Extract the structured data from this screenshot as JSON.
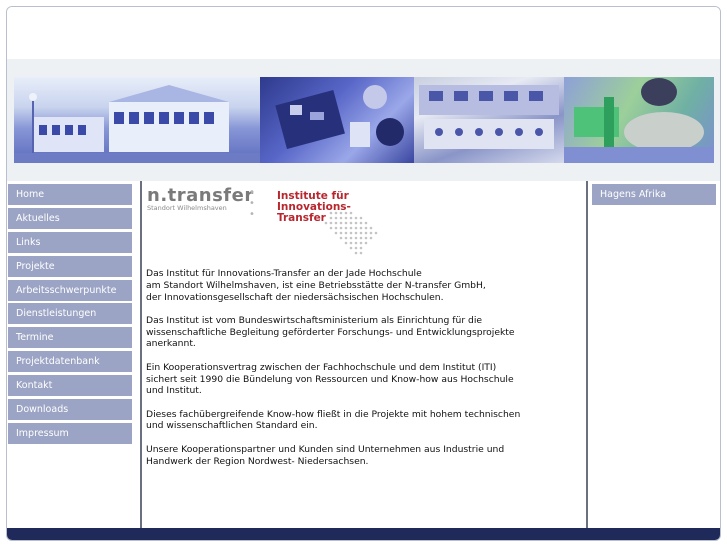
{
  "nav": {
    "items": [
      {
        "label": "Home"
      },
      {
        "label": "Aktuelles"
      },
      {
        "label": "Links"
      },
      {
        "label": "Projekte"
      },
      {
        "label": "Arbeitsschwerpunkte"
      },
      {
        "label": "Dienstleistungen"
      },
      {
        "label": "Termine"
      },
      {
        "label": "Projektdatenbank"
      },
      {
        "label": "Kontakt"
      },
      {
        "label": "Downloads"
      },
      {
        "label": "Impressum"
      }
    ]
  },
  "sidebar": {
    "link": "Hagens Afrika"
  },
  "logos": {
    "ntransfer": "n.transfer",
    "ntransfer_sub": "Standort Wilhelmshaven",
    "institute_line1": "Institute für",
    "institute_line2": "Innovations-",
    "institute_line3": "Transfer"
  },
  "content": {
    "paragraphs": [
      "Das Institut für Innovations-Transfer an der Jade Hochschule\nam Standort Wilhelmshaven, ist eine Betriebsstätte der N-transfer GmbH,\nder Innovationsgesellschaft der niedersächsischen Hochschulen.",
      "Das Institut ist vom Bundeswirtschaftsministerium als Einrichtung für die\nwissenschaftliche Begleitung geförderter Forschungs- und Entwicklungsprojekte\nanerkannt.",
      "Ein Kooperationsvertrag zwischen der Fachhochschule und dem Institut (ITI)\nsichert seit 1990 die Bündelung von Ressourcen und Know-how aus Hochschule\nund Institut.",
      "Dieses fachübergreifende Know-how fließt in die Projekte mit hohem technischen\nund wissenschaftlichen Standard ein.",
      "Unsere Kooperationspartner und Kunden sind Unternehmen aus Industrie und\nHandwerk der Region Nordwest- Niedersachsen."
    ]
  },
  "colors": {
    "nav_bg": "#9ba4c4",
    "footer_bar": "#1f2a5a",
    "institute_red": "#b8262e"
  }
}
